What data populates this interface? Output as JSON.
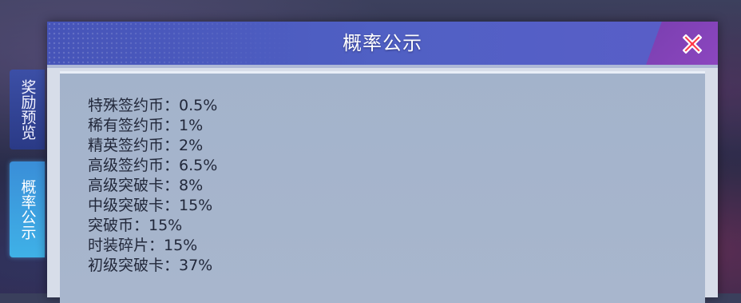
{
  "dialog": {
    "title": "概率公示"
  },
  "side_tabs": [
    {
      "label": "奖励预览"
    },
    {
      "label": "概率公示"
    }
  ],
  "rates": [
    {
      "text": "特殊签约币：0.5%"
    },
    {
      "text": "稀有签约币：1%"
    },
    {
      "text": "精英签约币：2%"
    },
    {
      "text": "高级签约币：6.5%"
    },
    {
      "text": "高级突破卡：8%"
    },
    {
      "text": "中级突破卡：15%"
    },
    {
      "text": "突破币：15%"
    },
    {
      "text": "时装碎片：15%"
    },
    {
      "text": "初级突破卡：37%"
    }
  ],
  "colors": {
    "title_bar": "#4f5dc2",
    "close_icon": "#ff3b4a",
    "active_tab": "#3fa6e2",
    "inactive_tab": "#2f3f8e",
    "content_panel": "#a5b4cc"
  }
}
